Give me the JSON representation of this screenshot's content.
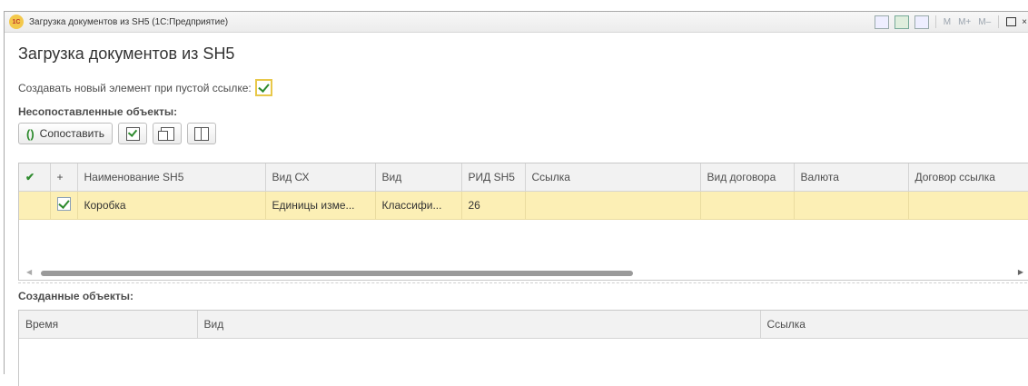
{
  "window": {
    "title": "Загрузка документов из SH5  (1С:Предприятие)",
    "logo_text": "1С",
    "toolbar_m": [
      "M",
      "M+",
      "M–"
    ]
  },
  "form": {
    "title": "Загрузка документов из SH5",
    "create_new_label": "Создавать новый элемент при пустой ссылке:",
    "create_new_checked": true,
    "unmatched_label": "Несопоставленные объекты:",
    "match_button": "Сопоставить",
    "created_label": "Созданные объекты:"
  },
  "unmatched_table": {
    "columns": [
      "",
      "+",
      "Наименование SH5",
      "Вид СХ",
      "Вид",
      "РИД SH5",
      "Ссылка",
      "Вид договора",
      "Валюта",
      "Договор ссылка"
    ],
    "rows": [
      {
        "checked": true,
        "name": "Коробка",
        "vid_sx": "Единицы изме...",
        "vid": "Классифи...",
        "rid": "26",
        "ref": "",
        "contract_type": "",
        "currency": "",
        "contract_ref": ""
      }
    ]
  },
  "created_table": {
    "columns": [
      "Время",
      "Вид",
      "Ссылка"
    ]
  },
  "colors": {
    "selected_row": "#fcefb5",
    "check_green": "#2e8b2e"
  }
}
